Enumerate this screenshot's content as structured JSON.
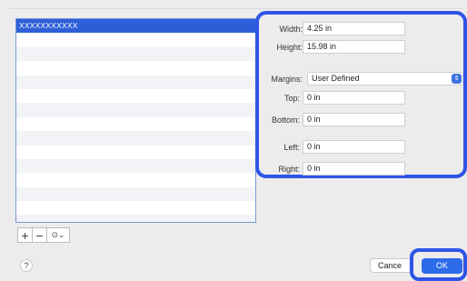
{
  "list": {
    "rows": [
      "XXXXXXXXXXX",
      "",
      "",
      "",
      "",
      "",
      "",
      "",
      "",
      "",
      "",
      "",
      "",
      "",
      ""
    ]
  },
  "toolbar": {
    "add_label": "+",
    "remove_label": "−",
    "options_label": "⊙⌄"
  },
  "form": {
    "width_label": "Width:",
    "width_value": "4.25 in",
    "height_label": "Height:",
    "height_value": "15.98 in",
    "margins_label": "Margins:",
    "margins_value": "User Defined",
    "top_label": "Top:",
    "top_value": "0 in",
    "bottom_label": "Bottom:",
    "bottom_value": "0 in",
    "left_label": "Left:",
    "left_value": "0 in",
    "right_label": "Right:",
    "right_value": "0 in"
  },
  "footer": {
    "help_label": "?",
    "cancel_label": "Cance",
    "ok_label": "OK"
  },
  "colors": {
    "highlight": "#2f55e6",
    "selection": "#2d5fd8",
    "ok_button": "#2d6bea"
  }
}
